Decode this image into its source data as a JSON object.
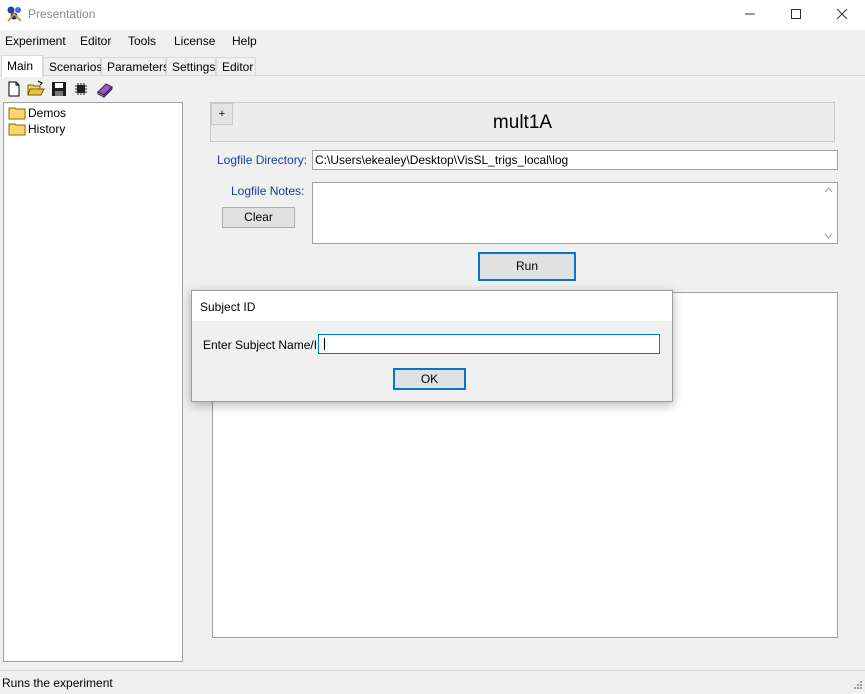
{
  "window": {
    "title": "Presentation",
    "icon": "presentation-app-icon",
    "controls": [
      "minimize-icon",
      "maximize-icon",
      "close-icon"
    ]
  },
  "menu": [
    "Experiment",
    "Editor",
    "Tools",
    "License",
    "Help"
  ],
  "tabs": [
    {
      "label": "Main",
      "active": true
    },
    {
      "label": "Scenarios",
      "active": false
    },
    {
      "label": "Parameters",
      "active": false
    },
    {
      "label": "Settings",
      "active": false
    },
    {
      "label": "Editor",
      "active": false
    }
  ],
  "toolbar": {
    "icons": [
      "new-file-icon",
      "open-folder-icon",
      "save-icon",
      "chip-icon",
      "books-icon"
    ]
  },
  "tree": {
    "items": [
      {
        "label": "Demos",
        "icon": "folder-icon"
      },
      {
        "label": "History",
        "icon": "folder-icon"
      }
    ]
  },
  "experiment": {
    "expand_symbol": "+",
    "title": "mult1A",
    "logfile_dir_label": "Logfile Directory:",
    "logfile_dir_value": "C:\\Users\\ekealey\\Desktop\\VisSL_trigs_local\\log",
    "logfile_notes_label": "Logfile Notes:",
    "logfile_notes_value": "",
    "clear_label": "Clear",
    "run_label": "Run"
  },
  "dialog": {
    "title": "Subject ID",
    "label": "Enter Subject Name/ID:",
    "input_value": "",
    "ok_label": "OK"
  },
  "status": {
    "text": "Runs the experiment"
  },
  "colors": {
    "label_blue": "#1e3c8c",
    "focus_blue": "#0078d7",
    "folder_yellow": "#f5d76e"
  }
}
